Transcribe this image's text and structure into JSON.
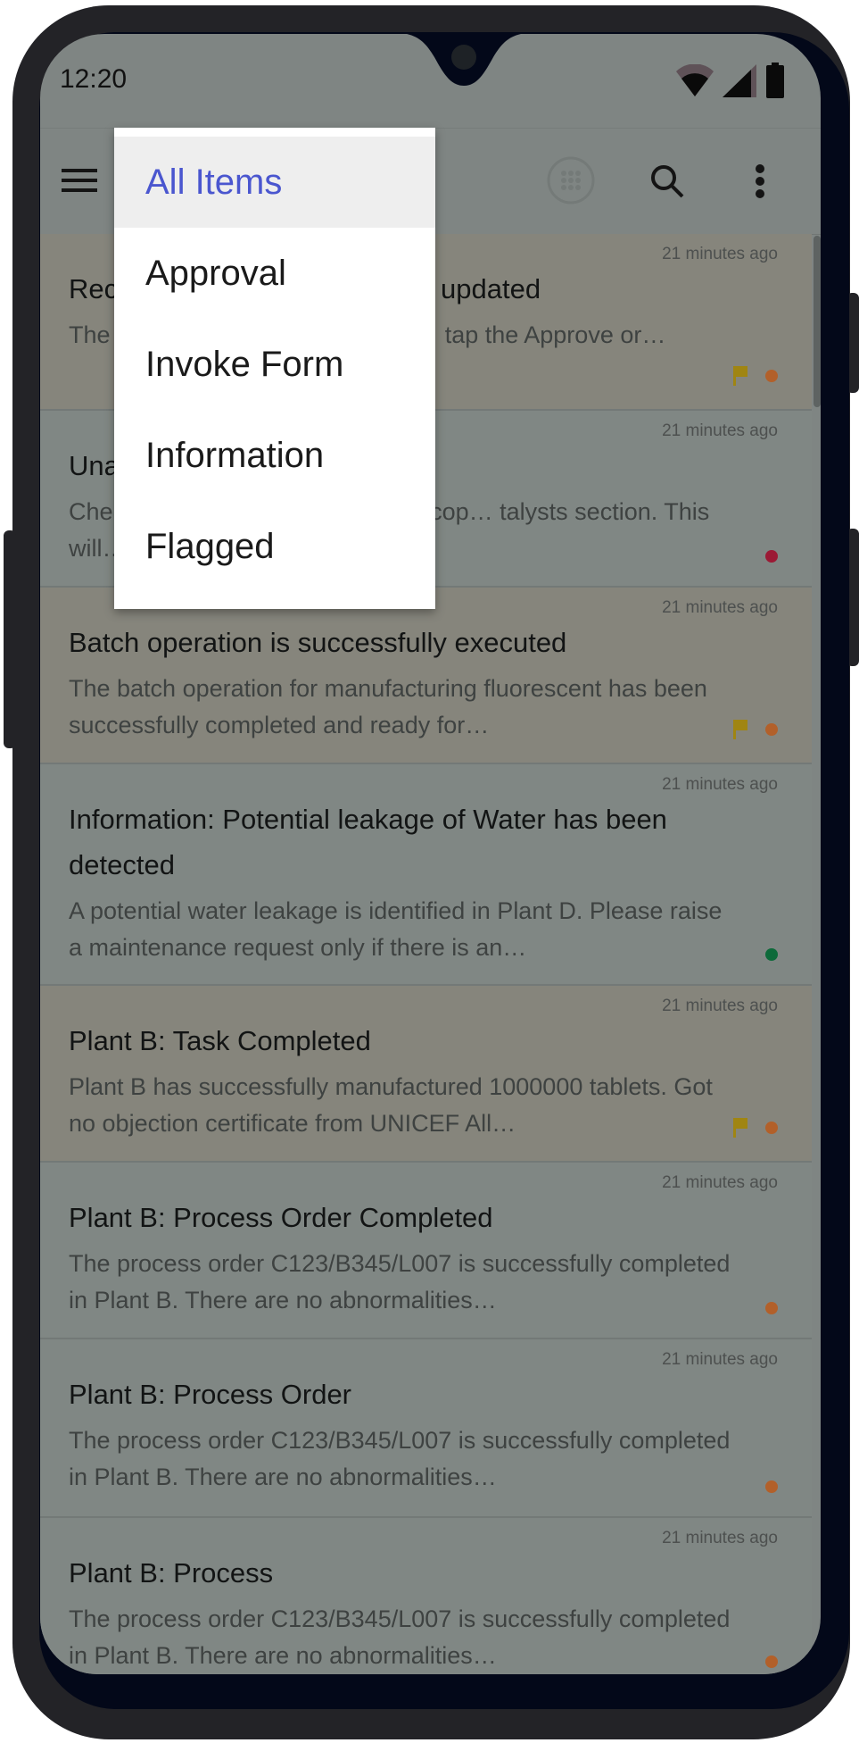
{
  "status_bar": {
    "time": "12:20",
    "icons": [
      "wifi-icon",
      "cellular-signal-icon",
      "battery-icon"
    ]
  },
  "toolbar": {
    "icons": [
      "menu-icon",
      "apps-grid-icon",
      "search-icon",
      "more-vert-icon"
    ]
  },
  "filter_menu": {
    "items": [
      {
        "label": "All Items",
        "selected": true
      },
      {
        "label": "Approval",
        "selected": false
      },
      {
        "label": "Invoke Form",
        "selected": false
      },
      {
        "label": "Information",
        "selected": false
      },
      {
        "label": "Flagged",
        "selected": false
      }
    ],
    "selected_color": "#4a56cf"
  },
  "list": {
    "items": [
      {
        "title": "Recipe has been successfully updated",
        "title_visible": "Rec… ully updated",
        "body": "The … ssfully modified and requ… tap the Approve or…",
        "time_ago": "21 minutes ago",
        "flagged": true,
        "status": "orange"
      },
      {
        "title": "Una… rials",
        "body": "Che… ge of raw materials (silver, cop… talysts section. This will…",
        "time_ago": "21 minutes ago",
        "flagged": false,
        "status": "red"
      },
      {
        "title": "Batch operation is successfully executed",
        "body": "The batch operation for manufacturing fluorescent has been successfully completed and ready for…",
        "time_ago": "21 minutes ago",
        "flagged": true,
        "status": "orange"
      },
      {
        "title": "Information: Potential leakage of Water has been detected",
        "body": "A potential water leakage is identified in Plant D. Please raise a maintenance request only if there is an…",
        "time_ago": "21 minutes ago",
        "flagged": false,
        "status": "green"
      },
      {
        "title": "Plant B: Task Completed",
        "body": "Plant B has successfully manufactured 1000000 tablets. Got no objection certificate from UNICEF All…",
        "time_ago": "21 minutes ago",
        "flagged": true,
        "status": "orange"
      },
      {
        "title": "Plant B: Process Order Completed",
        "body": "The process order C123/B345/L007 is successfully completed in Plant B. There are no abnormalities…",
        "time_ago": "21 minutes ago",
        "flagged": false,
        "status": "orange"
      },
      {
        "title": "Plant B: Process Order",
        "body": "The process order C123/B345/L007 is successfully completed in Plant B. There are no abnormalities…",
        "time_ago": "21 minutes ago",
        "flagged": false,
        "status": "orange"
      },
      {
        "title": "Plant B: Process",
        "body": "The process order C123/B345/L007 is successfully completed in Plant B. There are no abnormalities…",
        "time_ago": "21 minutes ago",
        "flagged": false,
        "status": "orange"
      }
    ]
  },
  "colors": {
    "status_orange": "#b2602a",
    "status_red": "#9b1a35",
    "status_green": "#0d6a3a",
    "flag": "#a08512",
    "scrim_background": "#7f8583",
    "flagged_background": "#86857c"
  }
}
